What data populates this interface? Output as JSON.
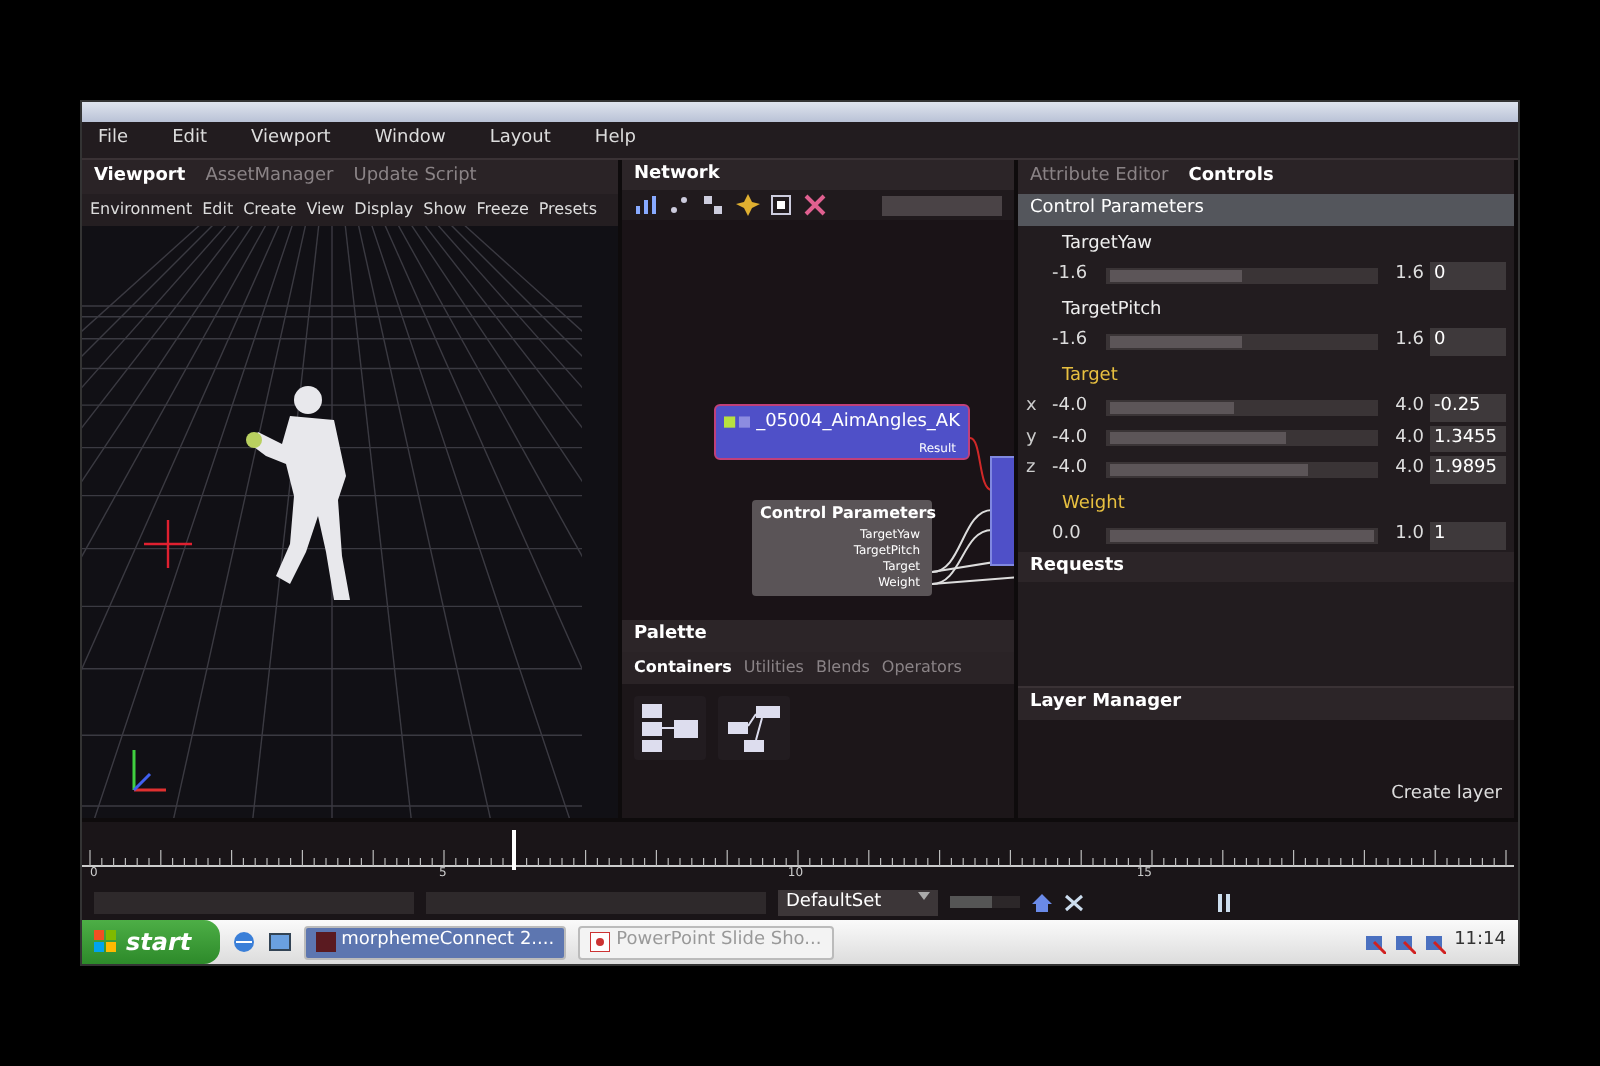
{
  "menu": [
    "File",
    "Edit",
    "Viewport",
    "Window",
    "Layout",
    "Help"
  ],
  "viewport_panel": {
    "tabs": [
      {
        "label": "Viewport",
        "selected": true
      },
      {
        "label": "AssetManager",
        "selected": false
      },
      {
        "label": "Update Script",
        "selected": false
      }
    ],
    "toolbar": [
      "Environment",
      "Edit",
      "Create",
      "View",
      "Display",
      "Show",
      "Freeze",
      "Presets"
    ]
  },
  "network_panel": {
    "title": "Network",
    "nodes": [
      {
        "kind": "animation",
        "title": "_05004_AimAngles_AK",
        "outputs": [
          "Result"
        ]
      },
      {
        "kind": "control",
        "title": "Control Parameters",
        "outputs": [
          "TargetYaw",
          "TargetPitch",
          "Target",
          "Weight"
        ]
      }
    ]
  },
  "palette": {
    "title": "Palette",
    "tabs": [
      {
        "label": "Containers",
        "selected": true
      },
      {
        "label": "Utilities",
        "selected": false
      },
      {
        "label": "Blends",
        "selected": false
      },
      {
        "label": "Operators",
        "selected": false
      }
    ]
  },
  "attribute_panel": {
    "tabs": [
      {
        "label": "Attribute Editor",
        "selected": false
      },
      {
        "label": "Controls",
        "selected": true
      }
    ],
    "section": "Control Parameters",
    "parameters": [
      {
        "name": "TargetYaw",
        "highlighted": false,
        "rows": [
          {
            "axis": "",
            "min": "-1.6",
            "max": "1.6",
            "value": "0",
            "level": 0.5
          }
        ]
      },
      {
        "name": "TargetPitch",
        "highlighted": false,
        "rows": [
          {
            "axis": "",
            "min": "-1.6",
            "max": "1.6",
            "value": "0",
            "level": 0.5
          }
        ]
      },
      {
        "name": "Target",
        "highlighted": true,
        "rows": [
          {
            "axis": "x",
            "min": "-4.0",
            "max": "4.0",
            "value": "-0.25",
            "level": 0.47
          },
          {
            "axis": "y",
            "min": "-4.0",
            "max": "4.0",
            "value": "1.3455",
            "level": 0.67
          },
          {
            "axis": "z",
            "min": "-4.0",
            "max": "4.0",
            "value": "1.9895",
            "level": 0.75
          }
        ]
      },
      {
        "name": "Weight",
        "highlighted": true,
        "rows": [
          {
            "axis": "",
            "min": "0.0",
            "max": "1.0",
            "value": "1",
            "level": 1.0
          }
        ]
      }
    ],
    "requests_title": "Requests"
  },
  "layer_manager": {
    "title": "Layer Manager",
    "button": "Create layer"
  },
  "timeline": {
    "ticks": [
      "0",
      "5",
      "10",
      "15"
    ],
    "level": 0.3
  },
  "status_bar": {
    "set": "DefaultSet",
    "level": 0.6
  },
  "taskbar": {
    "start": "start",
    "tasks": [
      {
        "label": "morphemeConnect 2....",
        "selected": true
      },
      {
        "label": "PowerPoint Slide Sho...",
        "selected": false
      }
    ],
    "clock": "11:14"
  }
}
